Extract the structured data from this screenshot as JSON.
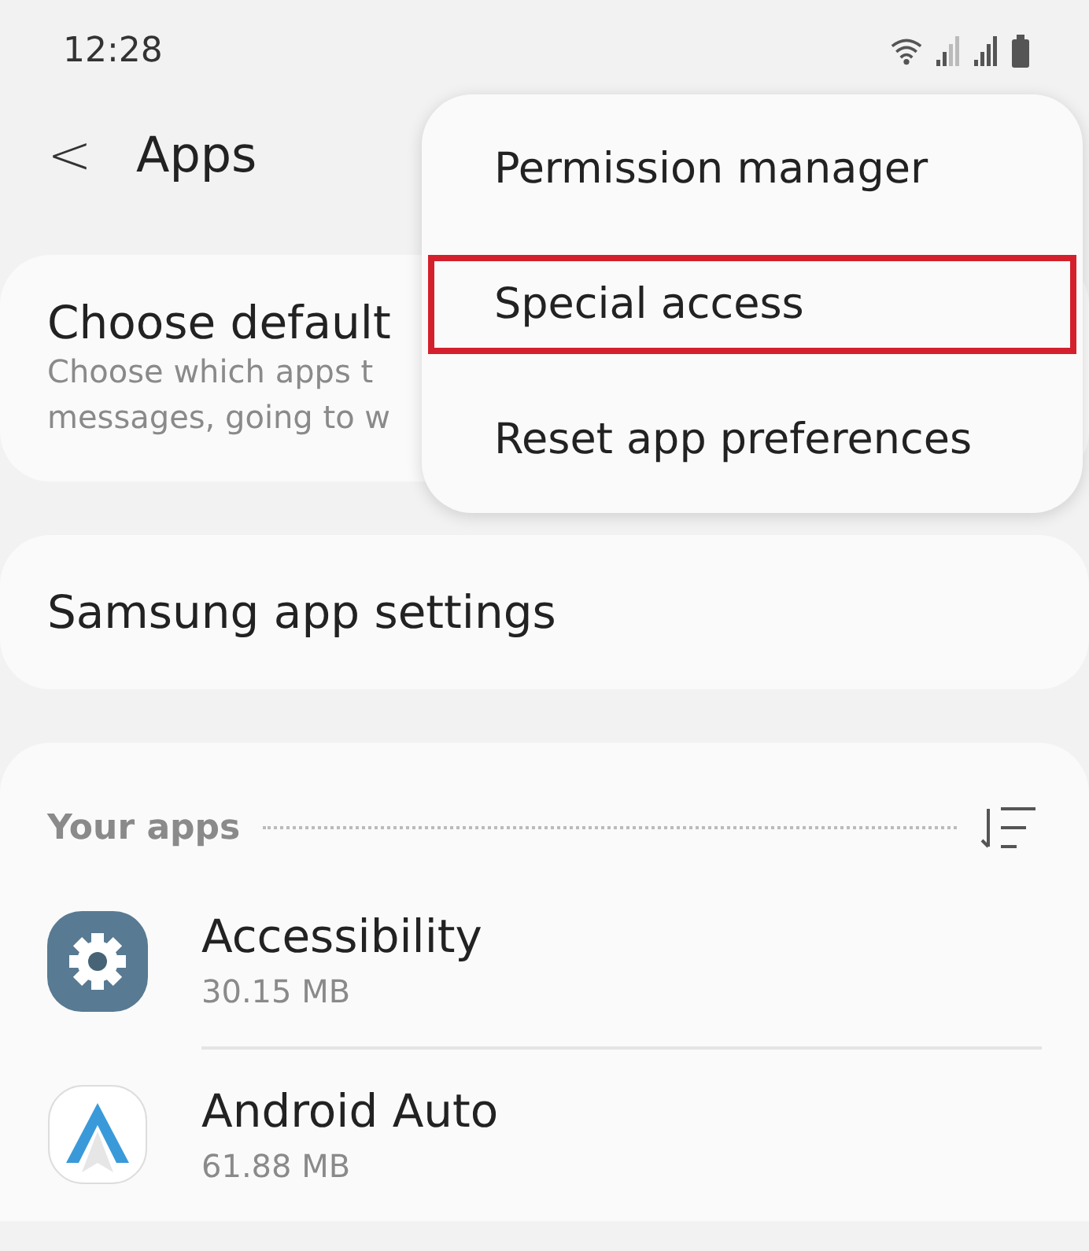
{
  "status_bar": {
    "time": "12:28"
  },
  "header": {
    "back": "<",
    "title": "Apps"
  },
  "cards": [
    {
      "title": "Choose default",
      "lines": [
        "Choose which apps t",
        "messages, going to w"
      ]
    },
    {
      "title": "Samsung app settings"
    }
  ],
  "apps_section": {
    "title": "Your apps",
    "apps": [
      {
        "kind": "gear",
        "name": "Accessibility",
        "size": "30.15 MB"
      },
      {
        "kind": "auto",
        "name": "Android Auto",
        "size": "61.88 MB"
      }
    ]
  },
  "menu": {
    "items": [
      {
        "label": "Permission manager",
        "highlighted": false
      },
      {
        "label": "Special access",
        "highlighted": true
      },
      {
        "label": "Reset app preferences",
        "highlighted": false
      }
    ]
  }
}
